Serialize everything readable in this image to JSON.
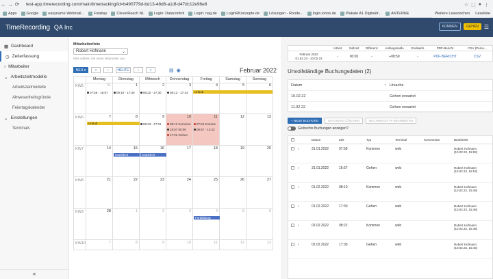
{
  "browser": {
    "url": "test-app.timerecording.com/main/timetracking/id=b490779d-bd13-48d6-a1df-d47dc12e96e8",
    "bookmarks": [
      "Apps",
      "Google",
      "easyname Webmail...",
      "Fixabay",
      "CleverReach NL",
      "Login: Datacontrol",
      "Login: nag.de",
      "LoginRKonzepte.de",
      "Lösungen - Ronde...",
      "login.ionos.de",
      "Plakate A1 Digitaldr...",
      "ANTENNE"
    ],
    "bookmarks_right": [
      "Weitere Lesezeichen",
      "Leseliste"
    ]
  },
  "app": {
    "logo": "TimeRecording",
    "company": "QA Inc",
    "top_btn1": "KOMMEN",
    "top_btn2": "GEHEN"
  },
  "sidebar": {
    "items": [
      {
        "label": "Dashboard",
        "icon": "dashboard-icon",
        "active": false
      },
      {
        "label": "Zeiterfassung",
        "icon": "clock-icon",
        "active": true
      },
      {
        "label": "Mitarbeiter",
        "icon": "chevron-right-icon",
        "active": false
      },
      {
        "label": "Arbeitszeitmodelle",
        "icon": "chevron-down-icon",
        "active": false
      }
    ],
    "subitems": [
      "Arbeitszeitmodelle",
      "Abwesenheitsgründe",
      "Feiertagskalender"
    ],
    "settings": "Einstellungen",
    "settings_sub": [
      "Terminals"
    ],
    "collapse": "«"
  },
  "employee": {
    "label": "Mitarbeiterliste",
    "selected": "Robert Hofmann",
    "hint": "Bitte wählen Sie einen Mitarbeiter aus"
  },
  "calendar": {
    "new_btn": "NEU ▾",
    "prev2": "«",
    "prev": "‹",
    "today": "HEUTE",
    "next": "›",
    "next2": "»",
    "title": "Februar 2022",
    "days": [
      "Montag",
      "Dienstag",
      "Mittwoch",
      "Donnerstag",
      "Freitag",
      "Samstag",
      "Sonntag"
    ],
    "weeks": [
      {
        "kw": "KW5",
        "dates": [
          "31",
          "1",
          "2",
          "3",
          "4",
          "5",
          "6"
        ]
      },
      {
        "kw": "KW6",
        "dates": [
          "7",
          "8",
          "9",
          "10",
          "11",
          "12",
          "13"
        ]
      },
      {
        "kw": "KW7",
        "dates": [
          "14",
          "15",
          "16",
          "17",
          "18",
          "19",
          "20"
        ]
      },
      {
        "kw": "KW8",
        "dates": [
          "21",
          "22",
          "23",
          "24",
          "25",
          "26",
          "27"
        ]
      },
      {
        "kw": "KW9",
        "dates": [
          "28",
          "1",
          "2",
          "3",
          "4",
          "5",
          "6"
        ]
      },
      {
        "kw": "KW10",
        "dates": [
          "7",
          "8",
          "9",
          "10",
          "11",
          "12",
          "13"
        ]
      }
    ],
    "events": {
      "w1_mon": "07:58 - 16:57",
      "w1_tue": "08:10 - 17:30",
      "w1_wed": "08:22 - 17:30",
      "w1_thu": "08:12 - 17:24",
      "w1_urlaub": "Urlaub",
      "w2_urlaub": "Urlaub",
      "w2_wed": "09:23 - 17:01",
      "w2_thu1": "08:12 Kommen",
      "w2_thu2": "15:57 00:00",
      "w2_thu3": "17:22 Gehen",
      "w2_fri1": "07:54 Komme",
      "w2_fri2": "08:57 - 14:22",
      "w3_k1": "Krankheit",
      "w3_k2": "Krankheit",
      "w5_fort": "Fortbildung"
    }
  },
  "summary": {
    "headers": [
      "",
      "Istzeit",
      "Sollzeit",
      "Differenz",
      "Anfangssaldo",
      "Endsaldo",
      "PDF-Bericht",
      "CSV (Perso..."
    ],
    "period": "Februar 2022",
    "range": "01.02.22 - 10.02.22",
    "values": [
      "-",
      "00:00",
      "-",
      "+08:59",
      "-"
    ],
    "pdf": "PDF-BERICHT",
    "csv": "CSV"
  },
  "incomplete": {
    "title": "Unvollständige Buchungsdaten (2)",
    "col_date": "Datum",
    "col_reason": "Ursache",
    "rows": [
      {
        "date": "10.02.22",
        "reason": "Gehen erwartet"
      },
      {
        "date": "11.02.22",
        "reason": "Gehen erwartet"
      }
    ]
  },
  "actions": {
    "new": "+ NEUE BUCHUNG",
    "delete": "BUCHUNG LÖSCHEN",
    "type": "BUCHUNGSTYP BEARBEITEN",
    "toggle_label": "Gelöschte Buchungen anzeigen?"
  },
  "bookings": {
    "headers": [
      "Datum",
      "Zeit",
      "Typ",
      "Terminal",
      "Kommentar",
      "Bearbeitet"
    ],
    "rows": [
      {
        "date": "31.01.2022",
        "time": "07:58",
        "type": "Kommen",
        "terminal": "web",
        "edited": "Robert Hofmann (10.02.22, 15:53)"
      },
      {
        "date": "31.01.2022",
        "time": "16:57",
        "type": "Gehen",
        "terminal": "web",
        "edited": "Robert Hofmann (10.02.22, 15:53)"
      },
      {
        "date": "01.02.2022",
        "time": "08:10",
        "type": "Kommen",
        "terminal": "web",
        "edited": "Robert Hofmann (10.02.22, 15:45)"
      },
      {
        "date": "01.02.2022",
        "time": "17:30",
        "type": "Gehen",
        "terminal": "web",
        "edited": "Robert Hofmann (10.02.22, 15:46)"
      },
      {
        "date": "02.02.2022",
        "time": "08:22",
        "type": "Kommen",
        "terminal": "web",
        "edited": "Robert Hofmann (10.02.22, 15:46)"
      },
      {
        "date": "02.02.2022",
        "time": "17:30",
        "type": "Gehen",
        "terminal": "web",
        "edited": "Robert Hofmann (10.02.22, 15:46)"
      }
    ]
  }
}
